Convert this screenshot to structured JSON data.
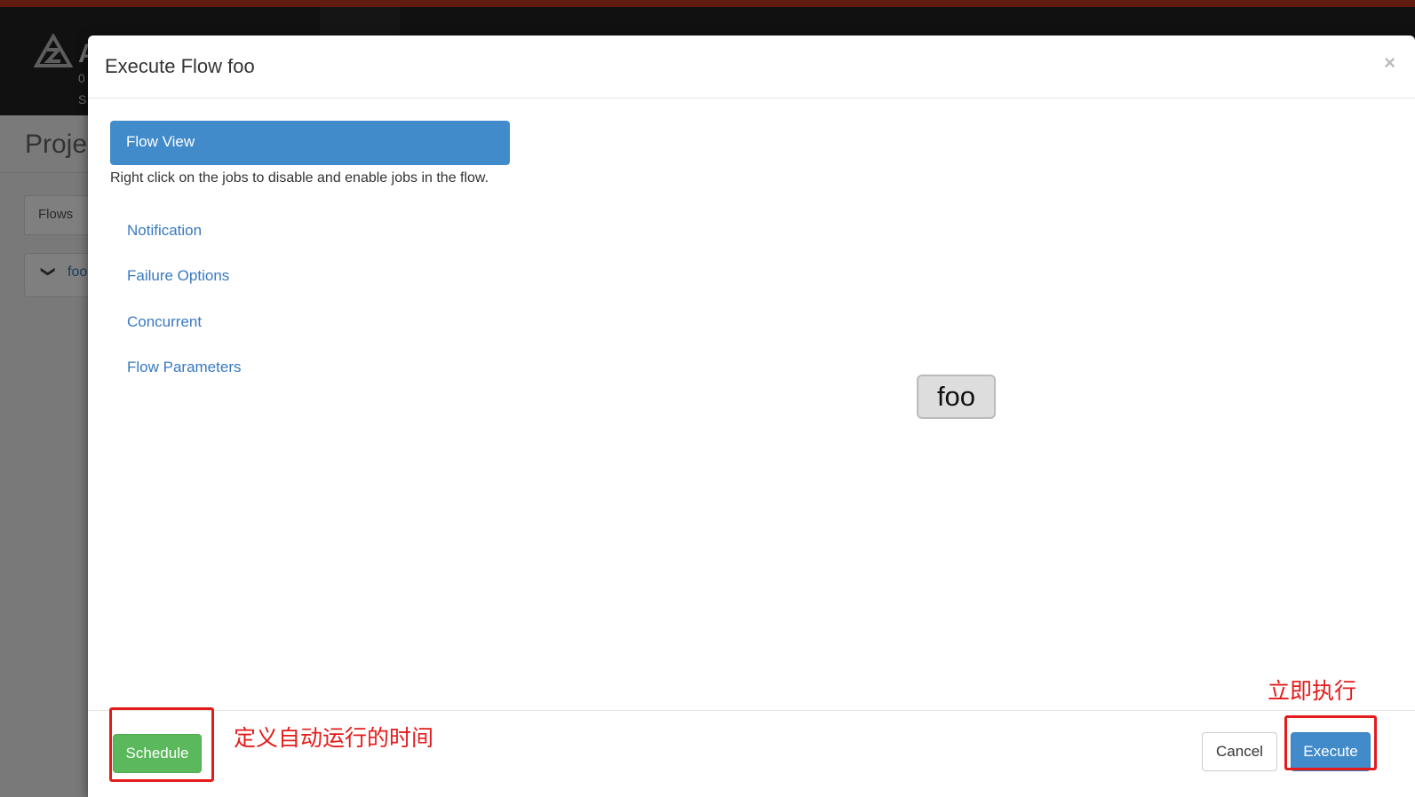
{
  "background": {
    "brand_letter": "A",
    "brand_line1": "0",
    "brand_line2": "S",
    "page_title": "Projec",
    "flows_tab": "Flows",
    "flow_name": "foo",
    "flow_toggle_glyph": "❯"
  },
  "modal": {
    "title": "Execute Flow foo",
    "close_glyph": "×",
    "sidebar": {
      "active_item": "Flow View",
      "hint": "Right click on the jobs to disable and enable jobs in the flow.",
      "links": [
        "Notification",
        "Failure Options",
        "Concurrent",
        "Flow Parameters"
      ]
    },
    "graph": {
      "node_label": "foo"
    },
    "footer": {
      "schedule_label": "Schedule",
      "cancel_label": "Cancel",
      "execute_label": "Execute"
    }
  },
  "annotations": {
    "schedule_note": "定义自动运行的时间",
    "execute_note": "立即执行",
    "color": "#e41b1b"
  },
  "colors": {
    "primary": "#428bca",
    "success": "#5cb85c",
    "header_accent": "#c5361f",
    "link": "#3879c1"
  }
}
